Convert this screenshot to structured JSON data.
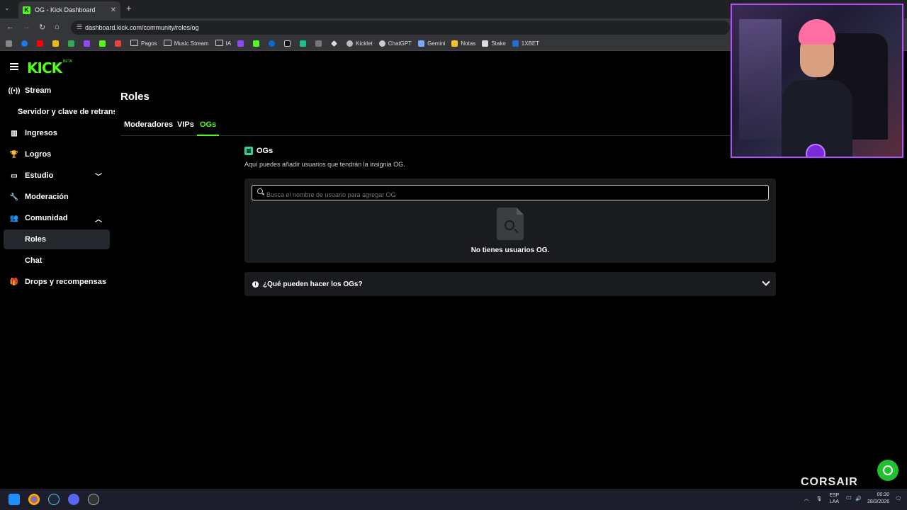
{
  "browser": {
    "tab_title": "OG - Kick Dashboard",
    "tab_close": "✕",
    "url": "dashboard.kick.com/community/roles/og",
    "bookmarks": [
      "Pagos",
      "Music Stream",
      "IA",
      "Kicklet",
      "ChatGPT",
      "Gemini",
      "Notas",
      "Stake",
      "1XBET"
    ]
  },
  "sidebar": {
    "logo": "KICK",
    "logo_beta": "BETA",
    "items": [
      {
        "label": "Stream"
      },
      {
        "label": "Servidor y clave de retransn"
      },
      {
        "label": "Ingresos"
      },
      {
        "label": "Logros"
      },
      {
        "label": "Estudio"
      },
      {
        "label": "Moderación"
      },
      {
        "label": "Comunidad"
      },
      {
        "label": "Roles"
      },
      {
        "label": "Chat"
      },
      {
        "label": "Drops y recompensas"
      }
    ]
  },
  "main": {
    "title": "Roles",
    "tabs": [
      {
        "label": "Moderadores"
      },
      {
        "label": "VIPs"
      },
      {
        "label": "OGs"
      }
    ],
    "section_title": "OGs",
    "section_desc": "Aquí puedes añadir usuarios que tendrán la insignia OG.",
    "search_placeholder": "Busca el nombre de usuario para agregar OG",
    "empty_text": "No tienes usuarios OG.",
    "faq_title": "¿Qué pueden hacer los OGs?"
  },
  "overlay": {
    "brand": "CORSAIR"
  },
  "taskbar": {
    "lang_1": "ESP",
    "lang_2": "LAA",
    "time": "00:30",
    "date": "28/3/2026"
  },
  "colors": {
    "accent": "#53fc18",
    "panel": "#191b1f",
    "active_nav": "#24272c",
    "og_badge": "#2ad4a0",
    "cam_border": "#b44cff"
  }
}
